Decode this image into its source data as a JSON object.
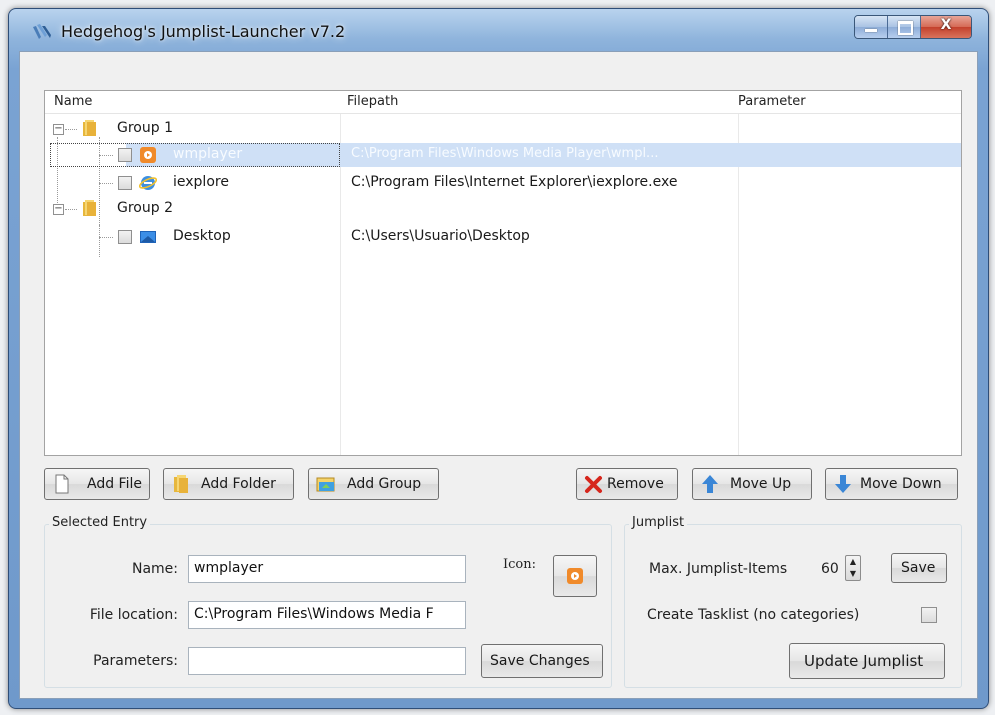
{
  "window": {
    "title": "Hedgehog's Jumplist-Launcher v7.2",
    "min_glyph": "",
    "max_glyph": "",
    "close_glyph": "X"
  },
  "tree": {
    "columns": [
      "Name",
      "Filepath",
      "Parameter"
    ],
    "groups": [
      {
        "label": "Group 1",
        "expander": "−"
      },
      {
        "label": "Group 2",
        "expander": "−"
      }
    ],
    "items": [
      {
        "name": "wmplayer",
        "filepath": "C:\\Program Files\\Windows Media Player\\wmpl...",
        "parameter": "",
        "icon": "media-player-icon",
        "checked": false,
        "selected": true
      },
      {
        "name": "iexplore",
        "filepath": "C:\\Program Files\\Internet Explorer\\iexplore.exe",
        "parameter": "",
        "icon": "internet-explorer-icon",
        "checked": false,
        "selected": false
      },
      {
        "name": "Desktop",
        "filepath": "C:\\Users\\Usuario\\Desktop",
        "parameter": "",
        "icon": "desktop-icon",
        "checked": false,
        "selected": false
      }
    ]
  },
  "buttons": {
    "add_file": "Add File",
    "add_folder": "Add Folder",
    "add_group": "Add Group",
    "remove": "Remove",
    "move_up": "Move Up",
    "move_down": "Move Down",
    "save_changes": "Save Changes",
    "save": "Save",
    "update_jumplist": "Update Jumplist"
  },
  "selected_entry": {
    "title": "Selected Entry",
    "name_label": "Name:",
    "name_value": "wmplayer",
    "location_label": "File location:",
    "location_value": "C:\\Program Files\\Windows Media F",
    "parameters_label": "Parameters:",
    "parameters_value": "",
    "icon_label": "Icon:"
  },
  "jumplist": {
    "title": "Jumplist",
    "max_items_label": "Max. Jumplist-Items",
    "max_items_value": "60",
    "tasklist_label": "Create Tasklist (no categories)",
    "tasklist_checked": false
  },
  "colors": {
    "selection": "#cfe0f6",
    "title_glass": "#8fb4dc",
    "close_red": "#c4412c"
  }
}
